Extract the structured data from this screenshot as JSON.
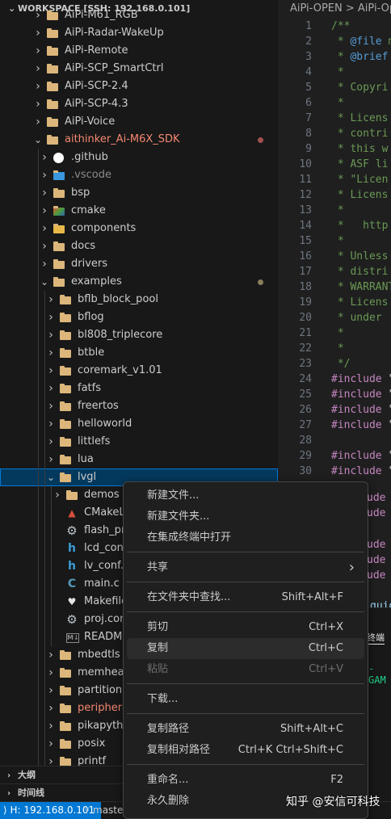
{
  "explorer": {
    "header": "WORKSPACE [SSH: 192.168.0.101]",
    "items": [
      {
        "label": "AiPi-M61_RGB"
      },
      {
        "label": "AiPi-Radar-WakeUp"
      },
      {
        "label": "AiPi-Remote"
      },
      {
        "label": "AiPi-SCP_SmartCtrl"
      },
      {
        "label": "AiPi-SCP-2.4"
      },
      {
        "label": "AiPi-SCP-4.3"
      },
      {
        "label": "AiPi-Voice"
      },
      {
        "label": "aithinker_Ai-M6X_SDK"
      },
      {
        "label": ".github"
      },
      {
        "label": ".vscode"
      },
      {
        "label": "bsp"
      },
      {
        "label": "cmake"
      },
      {
        "label": "components"
      },
      {
        "label": "docs"
      },
      {
        "label": "drivers"
      },
      {
        "label": "examples"
      },
      {
        "label": "bflb_block_pool"
      },
      {
        "label": "bflog"
      },
      {
        "label": "bl808_triplecore"
      },
      {
        "label": "btble"
      },
      {
        "label": "coremark_v1.01"
      },
      {
        "label": "fatfs"
      },
      {
        "label": "freertos"
      },
      {
        "label": "helloworld"
      },
      {
        "label": "littlefs"
      },
      {
        "label": "lua"
      },
      {
        "label": "lvgl"
      },
      {
        "label": "demos"
      },
      {
        "label": "CMakeLists.txt"
      },
      {
        "label": "flash_prog_cfg.ini"
      },
      {
        "label": "lcd_conf.h"
      },
      {
        "label": "lv_conf.h"
      },
      {
        "label": "main.c"
      },
      {
        "label": "Makefile"
      },
      {
        "label": "proj.conf"
      },
      {
        "label": "README.md"
      },
      {
        "label": "mbedtls"
      },
      {
        "label": "memheap"
      },
      {
        "label": "partition"
      },
      {
        "label": "peripherals"
      },
      {
        "label": "pikapython"
      },
      {
        "label": "posix"
      },
      {
        "label": "printf"
      }
    ],
    "outline_label": "大纲",
    "timeline_label": "时间线"
  },
  "icons": {
    "readme_badge": "M↓"
  },
  "editor": {
    "breadcrumb": "AiPi-OPEN > AiPi-Open",
    "lines": [
      {
        "n": "1",
        "t": "/**"
      },
      {
        "n": "2",
        "t": " * @file m"
      },
      {
        "n": "3",
        "t": " * @brief"
      },
      {
        "n": "4",
        "t": " *"
      },
      {
        "n": "5",
        "t": " * Copyri"
      },
      {
        "n": "6",
        "t": " *"
      },
      {
        "n": "7",
        "t": " * Licens"
      },
      {
        "n": "8",
        "t": " * contri"
      },
      {
        "n": "9",
        "t": " * this w"
      },
      {
        "n": "10",
        "t": " * ASF li"
      },
      {
        "n": "11",
        "t": " * \"Licen"
      },
      {
        "n": "12",
        "t": " * Licens"
      },
      {
        "n": "13",
        "t": " *"
      },
      {
        "n": "14",
        "t": " *   http"
      },
      {
        "n": "15",
        "t": " *"
      },
      {
        "n": "16",
        "t": " * Unless"
      },
      {
        "n": "17",
        "t": " * distri"
      },
      {
        "n": "18",
        "t": " * WARRANT"
      },
      {
        "n": "19",
        "t": " * Licens"
      },
      {
        "n": "20",
        "t": " * under"
      },
      {
        "n": "21",
        "t": " *"
      },
      {
        "n": "22",
        "t": " *"
      },
      {
        "n": "23",
        "t": " */"
      },
      {
        "n": "24",
        "t": "#include \""
      },
      {
        "n": "25",
        "t": "#include \""
      },
      {
        "n": "26",
        "t": "#include \""
      },
      {
        "n": "27",
        "t": "#include \""
      },
      {
        "n": "28",
        "t": ""
      },
      {
        "n": "29",
        "t": "#include \""
      },
      {
        "n": "30",
        "t": "#include \""
      }
    ],
    "peek_lines": [
      "ude \"",
      "ude \"",
      "ude \"",
      "ude \"",
      "ude \""
    ],
    "guide_text": "guid",
    "panel_tab": "终端",
    "panel_output": "-GAM"
  },
  "context_menu": {
    "items": [
      {
        "label": "新建文件...",
        "key": ""
      },
      {
        "label": "新建文件夹...",
        "key": ""
      },
      {
        "label": "在集成终端中打开",
        "key": ""
      },
      {
        "label": "共享",
        "key": "›"
      },
      {
        "label": "在文件夹中查找...",
        "key": "Shift+Alt+F"
      },
      {
        "label": "剪切",
        "key": "Ctrl+X"
      },
      {
        "label": "复制",
        "key": "Ctrl+C"
      },
      {
        "label": "粘贴",
        "key": "Ctrl+V"
      },
      {
        "label": "下载...",
        "key": ""
      },
      {
        "label": "复制路径",
        "key": "Shift+Alt+C"
      },
      {
        "label": "复制相对路径",
        "key": "Ctrl+K Ctrl+Shift+C"
      },
      {
        "label": "重命名...",
        "key": "F2"
      },
      {
        "label": "永久删除",
        "key": ""
      }
    ]
  },
  "status_bar": {
    "remote": "H: 192.168.0.101",
    "branch": "maste"
  },
  "watermark": "知乎 @安信可科技",
  "colors": {
    "accent": "#0078d4",
    "selection": "#04395e",
    "modified_dot_red": "#a1514f",
    "modified_dot_yellow": "#8a7d5a",
    "git_changed_text": "#f48771"
  }
}
